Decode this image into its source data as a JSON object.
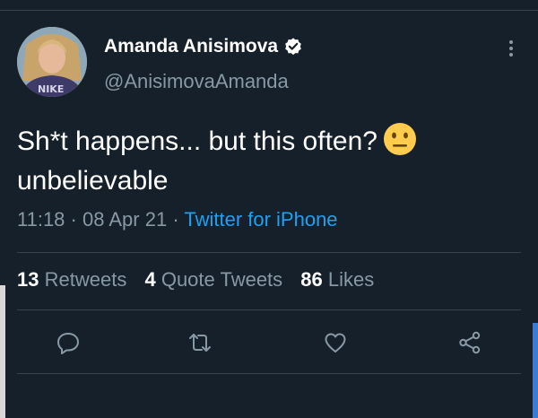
{
  "tweet": {
    "author": {
      "display_name": "Amanda Anisimova",
      "handle": "@AnisimovaAmanda",
      "avatar_shirt_text": "NIKE",
      "verified": true
    },
    "text_line1": "Sh*t happens... but this often?",
    "text_line2": "unbelievable",
    "emoji": "neutral-face",
    "time": "11:18",
    "date": "08 Apr 21",
    "separator": "·",
    "source": "Twitter for iPhone",
    "stats": {
      "retweets_count": "13",
      "retweets_label": "Retweets",
      "quotes_count": "4",
      "quotes_label": "Quote Tweets",
      "likes_count": "86",
      "likes_label": "Likes"
    }
  },
  "icons": [
    "more-icon",
    "verified-icon",
    "reply-icon",
    "retweet-icon",
    "like-icon",
    "share-icon"
  ],
  "colors": {
    "background": "#15202b",
    "secondary_text": "#8899a6",
    "accent": "#1da1f2",
    "divider": "#38444d"
  }
}
